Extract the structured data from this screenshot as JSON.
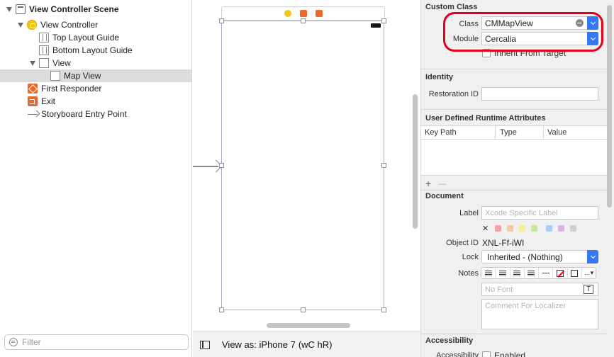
{
  "outline": {
    "items": [
      {
        "label": "View Controller Scene",
        "icon": "scene-icon"
      },
      {
        "label": "View Controller",
        "icon": "view-controller-icon"
      },
      {
        "label": "Top Layout Guide",
        "icon": "layout-guide-icon"
      },
      {
        "label": "Bottom Layout Guide",
        "icon": "layout-guide-icon"
      },
      {
        "label": "View",
        "icon": "view-icon"
      },
      {
        "label": "Map View",
        "icon": "view-icon"
      },
      {
        "label": "First Responder",
        "icon": "cube-icon"
      },
      {
        "label": "Exit",
        "icon": "exit-icon"
      },
      {
        "label": "Storyboard Entry Point",
        "icon": "arrow-icon"
      }
    ],
    "filter_placeholder": "Filter"
  },
  "bottom_bar": {
    "view_as": "View as: iPhone 7",
    "size_class": "(wC hR)"
  },
  "inspector": {
    "custom_class": {
      "title": "Custom Class",
      "class_label": "Class",
      "class_value": "CMMapView",
      "module_label": "Module",
      "module_value": "Cercalia",
      "inherit_label": "Inherit From Target"
    },
    "identity": {
      "title": "Identity",
      "restoration_label": "Restoration ID",
      "restoration_value": ""
    },
    "uda": {
      "title": "User Defined Runtime Attributes",
      "columns": [
        "Key Path",
        "Type",
        "Value"
      ],
      "add": "+",
      "remove": "—"
    },
    "document": {
      "title": "Document",
      "label_label": "Label",
      "label_placeholder": "Xcode Specific Label",
      "clear": "✕",
      "swatches": [
        "#f4a3a3",
        "#f6c9a0",
        "#f6ee9a",
        "#c5ea9b",
        "#a9cdf3",
        "#dcb1ec",
        "#d0d0d0"
      ],
      "object_id_label": "Object ID",
      "object_id_value": "XNL-Ff-iWI",
      "lock_label": "Lock",
      "lock_value": "Inherited - (Nothing)",
      "notes_label": "Notes",
      "font_placeholder": "No Font",
      "comment_placeholder": "Comment For Localizer"
    },
    "accessibility": {
      "title": "Accessibility",
      "row_label": "Accessibility",
      "enabled_label": "Enabled"
    }
  },
  "colors": {
    "accent": "#3478f6",
    "highlight": "#e3001b",
    "selection": "#dcdcdc"
  }
}
